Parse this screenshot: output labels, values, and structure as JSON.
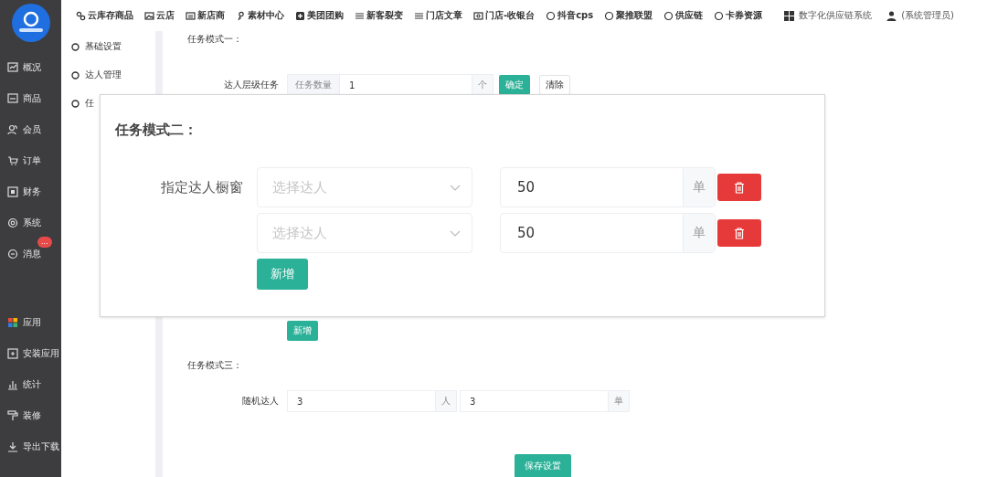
{
  "sidebar": {
    "main_items": [
      {
        "label": "概况"
      },
      {
        "label": "商品"
      },
      {
        "label": "会员"
      },
      {
        "label": "订单"
      },
      {
        "label": "财务"
      },
      {
        "label": "系统"
      },
      {
        "label": "消息",
        "badge": "..."
      }
    ],
    "app_items": [
      {
        "label": "应用"
      },
      {
        "label": "安装应用"
      },
      {
        "label": "统计"
      },
      {
        "label": "装修"
      },
      {
        "label": "导出下载"
      }
    ]
  },
  "top_nav": {
    "items": [
      "云库存商品",
      "云店",
      "新店商",
      "素材中心",
      "美团团购",
      "新客裂变",
      "门店文章",
      "门店-收银台",
      "抖音cps",
      "聚推联盟",
      "供应链",
      "卡券资源"
    ],
    "system": "数字化供应链系统",
    "user": "(系统管理员)"
  },
  "sub_menu": {
    "items": [
      "基础设置",
      "达人管理",
      "任"
    ]
  },
  "mode_one": {
    "title": "任务模式一：",
    "label": "达人层级任务",
    "prefix": "任务数量",
    "value": "1",
    "suffix": "个",
    "buttons": [
      {
        "label": "确定",
        "kind": "primary"
      },
      {
        "label": "清除",
        "kind": "plain"
      }
    ]
  },
  "mode_two_add_button": "新增",
  "mode_three": {
    "title": "任务模式三：",
    "label": "随机达人",
    "fields": [
      {
        "value": "3",
        "suffix": "人"
      },
      {
        "value": "3",
        "suffix": "单"
      }
    ]
  },
  "save_button": "保存设置",
  "modal": {
    "title": "任务模式二：",
    "label": "指定达人橱窗",
    "rows": [
      {
        "placeholder": "选择达人",
        "value": "50",
        "suffix": "单"
      },
      {
        "placeholder": "选择达人",
        "value": "50",
        "suffix": "单"
      }
    ],
    "add_button": "新增"
  }
}
